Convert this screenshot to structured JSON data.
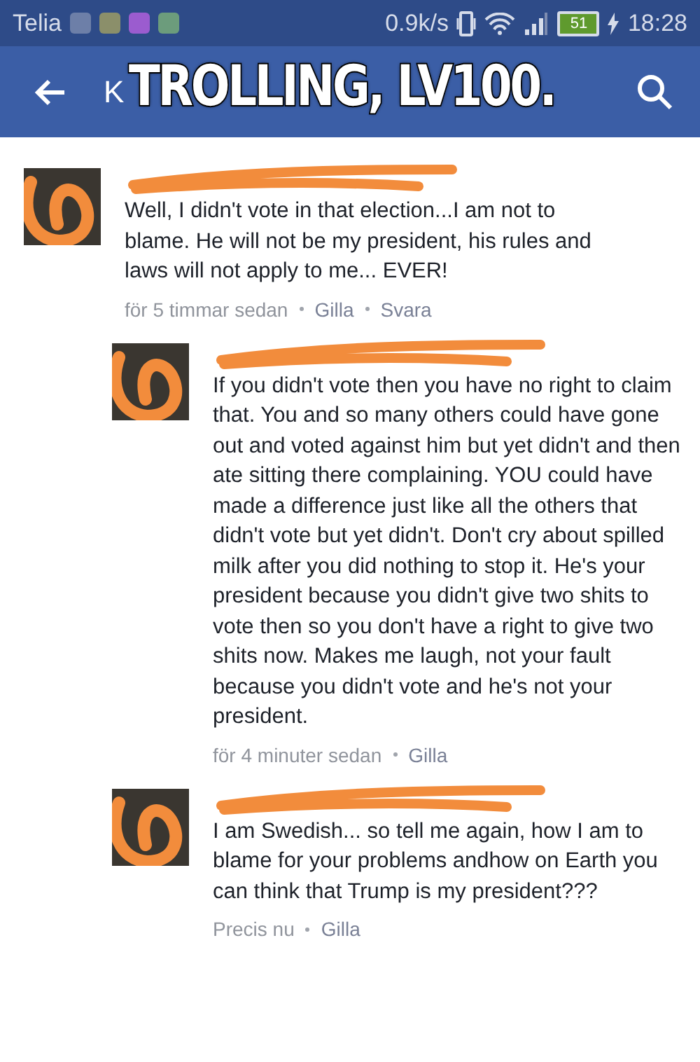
{
  "status_bar": {
    "carrier": "Telia",
    "speed": "0.9k/s",
    "battery": "51",
    "time": "18:28"
  },
  "header": {
    "title": "K"
  },
  "caption": "TROLLING, LV100.",
  "comments": [
    {
      "text": "Well, I didn't vote in that election...I am not to blame. He will not be my president, his rules and laws will not apply to me... EVER!",
      "time": "för 5 timmar sedan",
      "actions": [
        "Gilla",
        "Svara"
      ],
      "children": [
        {
          "text": "If you didn't vote then you have no right to claim that. You and so many others could have gone out and voted against him but yet didn't and then ate sitting there complaining. YOU could have made a difference just like all the others that didn't vote but yet didn't. Don't cry about spilled milk after you did nothing to stop it. He's your president because you didn't give two shits to vote then so you don't have a right to give two shits now. Makes me laugh, not your fault because you didn't vote and he's not your president.",
          "time": "för 4 minuter sedan",
          "actions": [
            "Gilla"
          ]
        },
        {
          "text": "I am Swedish... so tell me again, how I am to blame for your problems andhow on Earth you can think that Trump is my president???",
          "time": "Precis nu",
          "actions": [
            "Gilla"
          ]
        }
      ]
    }
  ]
}
